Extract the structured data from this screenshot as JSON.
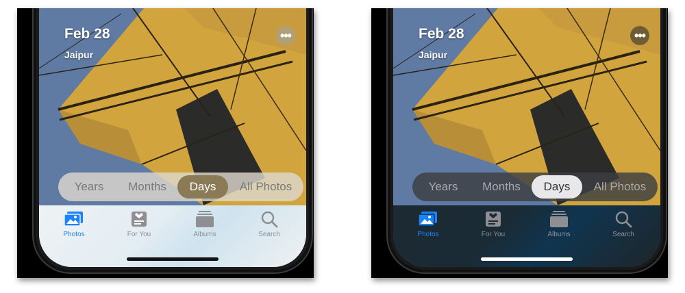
{
  "date": "Feb 28",
  "location": "Jaipur",
  "more_icon": "ellipsis-icon",
  "segments": [
    "Years",
    "Months",
    "Days",
    "All Photos"
  ],
  "active_segment": "Days",
  "tabs": [
    {
      "label": "Photos",
      "icon": "photos-icon",
      "active": true
    },
    {
      "label": "For You",
      "icon": "for-you-icon",
      "active": false
    },
    {
      "label": "Albums",
      "icon": "albums-icon",
      "active": false
    },
    {
      "label": "Search",
      "icon": "search-icon",
      "active": false
    }
  ],
  "colors": {
    "accent": "#1a84ff",
    "light_pill": "#8b7a56",
    "dark_pill": "#e8e8ea"
  }
}
